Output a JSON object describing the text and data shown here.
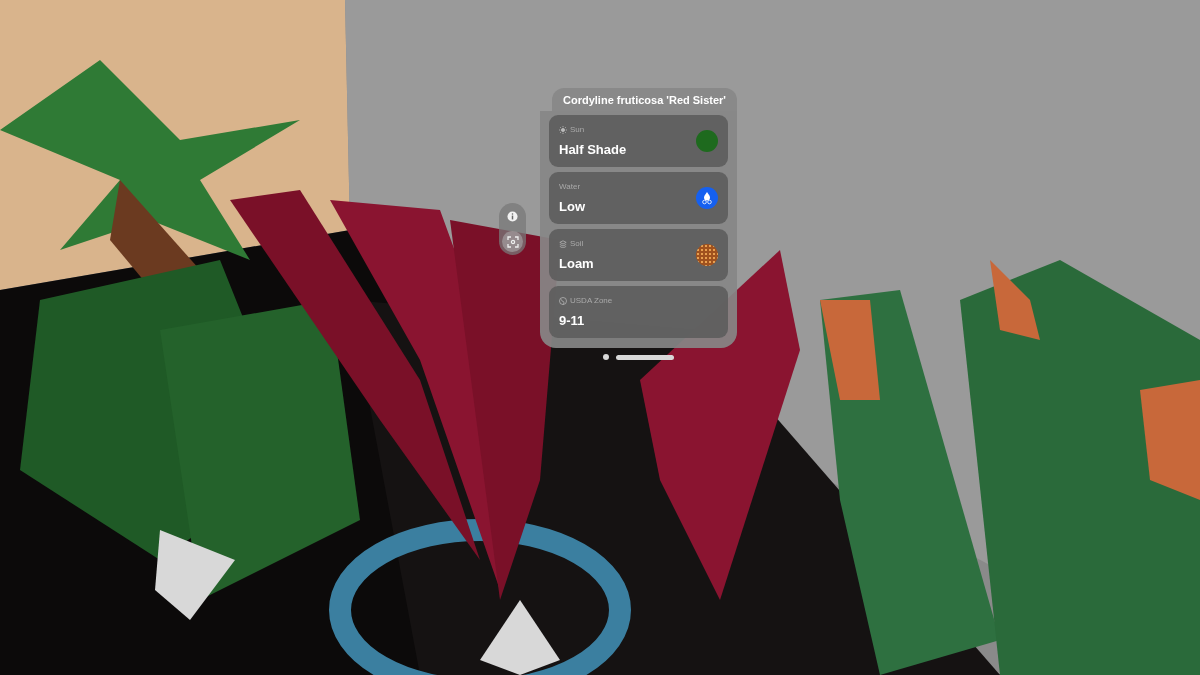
{
  "window": {
    "title": "Cordyline fruticosa 'Red Sister'"
  },
  "attributes": [
    {
      "kind": "sun",
      "label": "Sun",
      "value": "Half Shade",
      "color": "#1e6a1e"
    },
    {
      "kind": "water",
      "label": "Water",
      "value": "Low",
      "color": "#1560f0"
    },
    {
      "kind": "soil",
      "label": "Soil",
      "value": "Loam",
      "color": "#a0521e"
    },
    {
      "kind": "zone",
      "label": "USDA Zone",
      "value": "9-11"
    }
  ]
}
